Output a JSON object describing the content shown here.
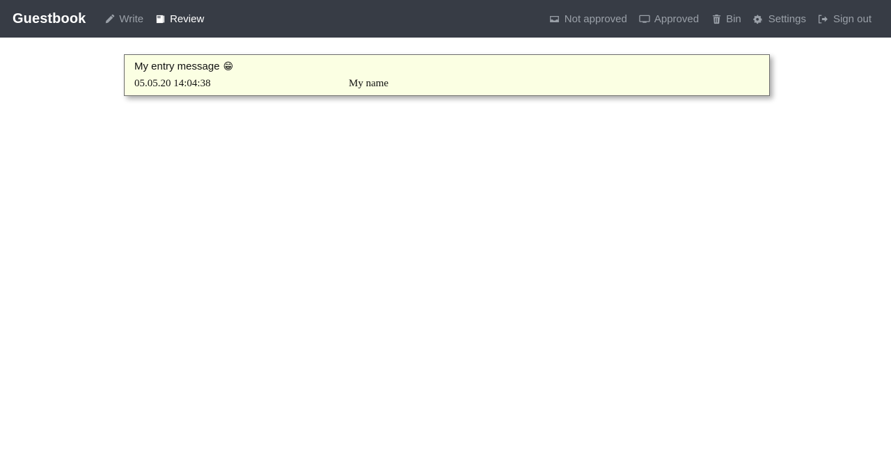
{
  "navbar": {
    "brand": "Guestbook",
    "left_links": [
      {
        "label": "Write",
        "icon": "pencil-icon",
        "active": false
      },
      {
        "label": "Review",
        "icon": "book-icon",
        "active": true
      }
    ],
    "right_links": [
      {
        "label": "Not approved",
        "icon": "inbox-icon"
      },
      {
        "label": "Approved",
        "icon": "monitor-icon"
      },
      {
        "label": "Bin",
        "icon": "trash-icon"
      },
      {
        "label": "Settings",
        "icon": "gears-icon"
      },
      {
        "label": "Sign out",
        "icon": "sign-out-icon"
      }
    ]
  },
  "colors": {
    "navbar_bg": "#373c45",
    "navbar_muted_text": "#9aa0a8",
    "navbar_active_text": "#ffffff",
    "page_bg": "#ffffff",
    "card_bg": "#fbffe3",
    "card_border": "#6d6d6d",
    "card_text": "#111111"
  },
  "entries": [
    {
      "message": "My entry message",
      "emoji": "😁",
      "date": "05.05.20 14:04:38",
      "author": "My name"
    }
  ]
}
